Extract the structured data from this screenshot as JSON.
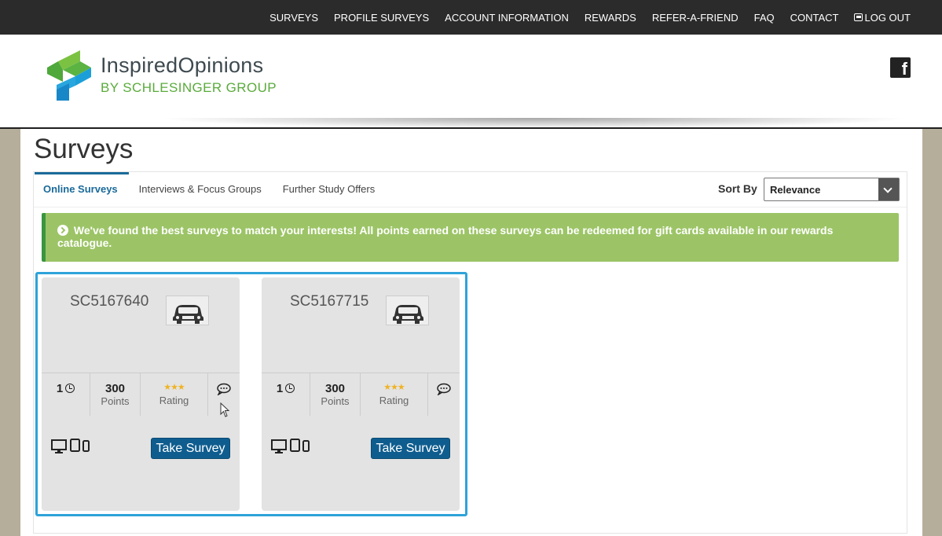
{
  "nav": {
    "items": [
      "SURVEYS",
      "PROFILE SURVEYS",
      "ACCOUNT INFORMATION",
      "REWARDS",
      "REFER-A-FRIEND",
      "FAQ",
      "CONTACT"
    ],
    "logout": "LOG OUT"
  },
  "header": {
    "logo_line1": "InspiredOpinions",
    "logo_line2": "BY SCHLESINGER GROUP",
    "social_icon": "facebook-icon"
  },
  "page": {
    "title": "Surveys"
  },
  "tabs": [
    {
      "label": "Online Surveys",
      "active": true
    },
    {
      "label": "Interviews & Focus Groups",
      "active": false
    },
    {
      "label": "Further Study Offers",
      "active": false
    }
  ],
  "sort": {
    "label": "Sort By",
    "selected": "Relevance"
  },
  "banner": {
    "text": "We've found the best surveys to match your interests! All points earned on these surveys can be redeemed for gift cards available in our rewards catalogue."
  },
  "surveys": [
    {
      "code": "SC5167640",
      "duration": "1",
      "points": "300",
      "points_label": "Points",
      "rating_label": "Rating",
      "stars": "★★★",
      "button": "Take Survey"
    },
    {
      "code": "SC5167715",
      "duration": "1",
      "points": "300",
      "points_label": "Points",
      "rating_label": "Rating",
      "stars": "★★★",
      "button": "Take Survey"
    }
  ],
  "colors": {
    "nav_bg": "#2b2b2b",
    "accent_blue": "#1a6a9a",
    "banner_green": "#9cc466",
    "button_blue": "#0f5d8f",
    "selection_outline": "#2ea3d9"
  }
}
